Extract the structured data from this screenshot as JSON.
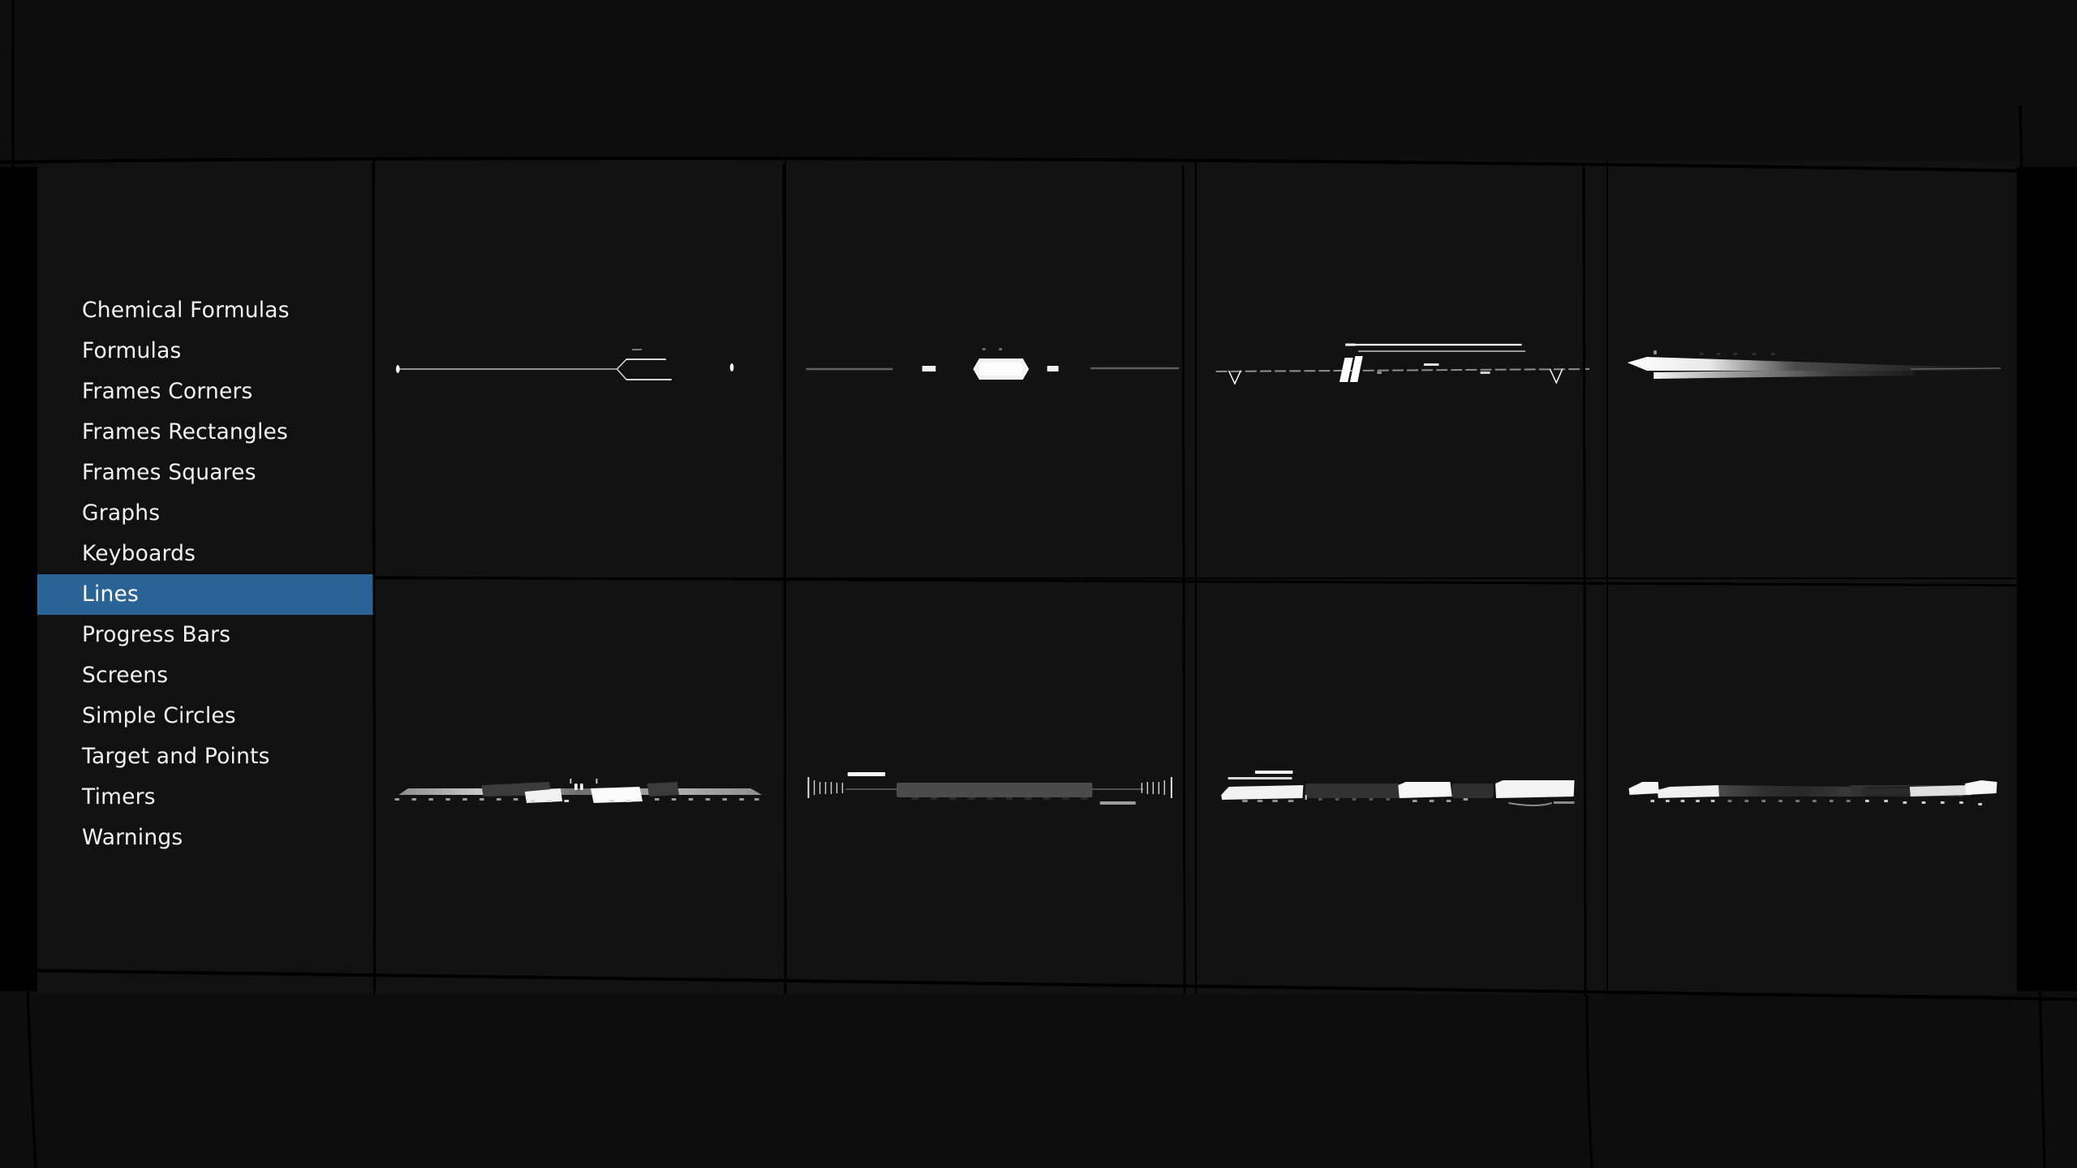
{
  "app": {
    "background_color": "#000000",
    "panel_color": "#121212",
    "accent_color": "#2a6496",
    "text_color": "#f2f2f2"
  },
  "sidebar": {
    "selected": "Lines",
    "items": [
      {
        "label": "Chemical Formulas",
        "selected": false
      },
      {
        "label": "Formulas",
        "selected": false
      },
      {
        "label": "Frames Corners",
        "selected": false
      },
      {
        "label": "Frames Rectangles",
        "selected": false
      },
      {
        "label": "Frames Squares",
        "selected": false
      },
      {
        "label": "Graphs",
        "selected": false
      },
      {
        "label": "Keyboards",
        "selected": false
      },
      {
        "label": "Lines",
        "selected": true
      },
      {
        "label": "Progress Bars",
        "selected": false
      },
      {
        "label": "Screens",
        "selected": false
      },
      {
        "label": "Simple Circles",
        "selected": false
      },
      {
        "label": "Target and Points",
        "selected": false
      },
      {
        "label": "Timers",
        "selected": false
      },
      {
        "label": "Warnings",
        "selected": false
      }
    ]
  },
  "grid": {
    "columns": 4,
    "rows": 2,
    "cells": [
      {
        "name": "line-preview-1",
        "style": "thin-fork-arrow-with-dots"
      },
      {
        "name": "line-preview-2",
        "style": "segmented-capsule-dashes"
      },
      {
        "name": "line-preview-3",
        "style": "dashed-notches-slashes-bracket"
      },
      {
        "name": "line-preview-4",
        "style": "bright-to-dim-gradient-bar"
      },
      {
        "name": "line-preview-5",
        "style": "ruler-ticks-center-blocks"
      },
      {
        "name": "line-preview-6",
        "style": "tick-ends-dim-center-bar"
      },
      {
        "name": "line-preview-7",
        "style": "alternating-parallelogram-blocks"
      },
      {
        "name": "line-preview-8",
        "style": "tapered-bar-with-ticks"
      }
    ]
  }
}
